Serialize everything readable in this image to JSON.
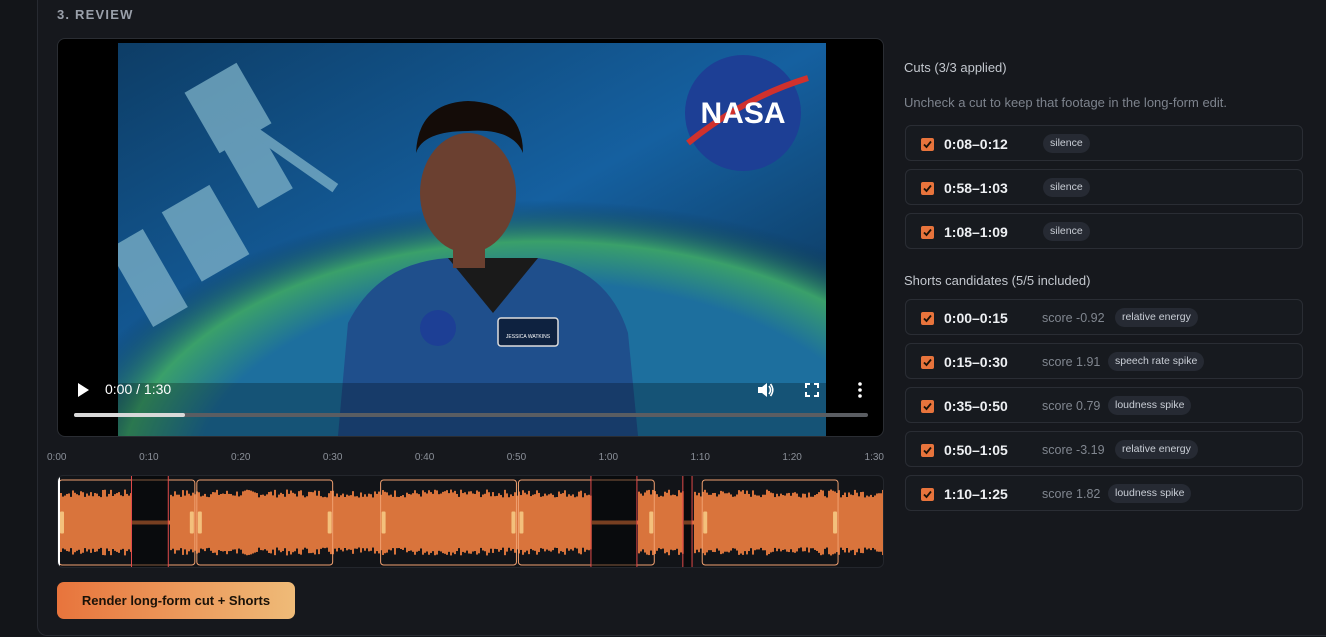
{
  "section": {
    "title": "3. REVIEW"
  },
  "player": {
    "time": "0:00 / 1:30",
    "progress": 0.14,
    "frame_logo_text": "NASA",
    "badge_text": "JESSICA WATKINS"
  },
  "timeline": {
    "ticks": [
      "0:00",
      "0:10",
      "0:20",
      "0:30",
      "0:40",
      "0:50",
      "1:00",
      "1:10",
      "1:20",
      "1:30"
    ],
    "duration_s": 90
  },
  "cuts": {
    "heading": "Cuts (3/3 applied)",
    "hint": "Uncheck a cut to keep that footage in the long-form edit.",
    "items": [
      {
        "range": "0:08–0:12",
        "tag": "silence",
        "checked": true
      },
      {
        "range": "0:58–1:03",
        "tag": "silence",
        "checked": true
      },
      {
        "range": "1:08–1:09",
        "tag": "silence",
        "checked": true
      }
    ]
  },
  "shorts": {
    "heading": "Shorts candidates (5/5 included)",
    "items": [
      {
        "range": "0:00–0:15",
        "score": "score -0.92",
        "tag": "relative energy",
        "checked": true
      },
      {
        "range": "0:15–0:30",
        "score": "score 1.91",
        "tag": "speech rate spike",
        "checked": true
      },
      {
        "range": "0:35–0:50",
        "score": "score 0.79",
        "tag": "loudness spike",
        "checked": true
      },
      {
        "range": "0:50–1:05",
        "score": "score -3.19",
        "tag": "relative energy",
        "checked": true
      },
      {
        "range": "1:10–1:25",
        "score": "score 1.82",
        "tag": "loudness spike",
        "checked": true
      }
    ]
  },
  "render_button": {
    "label": "Render long-form cut + Shorts"
  },
  "colors": {
    "accent": "#e8743c",
    "waveform": "#d9743c",
    "cut_marker": "#e04a4a"
  }
}
